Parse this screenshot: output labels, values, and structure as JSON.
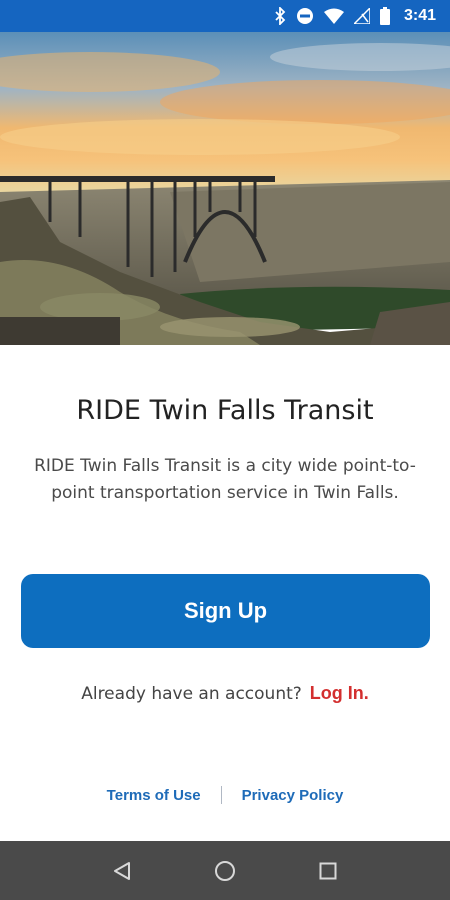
{
  "status_bar": {
    "time": "3:41",
    "icons": [
      "bluetooth-icon",
      "do-not-disturb-icon",
      "wifi-icon",
      "no-signal-icon",
      "battery-icon"
    ],
    "color": "#1565c0"
  },
  "hero": {
    "image": "perrine-bridge-canyon-sunset"
  },
  "main": {
    "title": "RIDE Twin Falls Transit",
    "description": "RIDE Twin Falls Transit is a city wide point-to-point transportation service in Twin Falls.",
    "signup_label": "Sign Up",
    "account_prompt": "Already have an account?",
    "login_label": "Log In."
  },
  "footer": {
    "terms_label": "Terms of Use",
    "privacy_label": "Privacy Policy"
  },
  "nav_bar": {
    "icons": [
      "back-icon",
      "home-icon",
      "recents-icon"
    ]
  },
  "colors": {
    "primary": "#0d6ebf",
    "login": "#d32f2f",
    "link": "#1e6bb8"
  }
}
